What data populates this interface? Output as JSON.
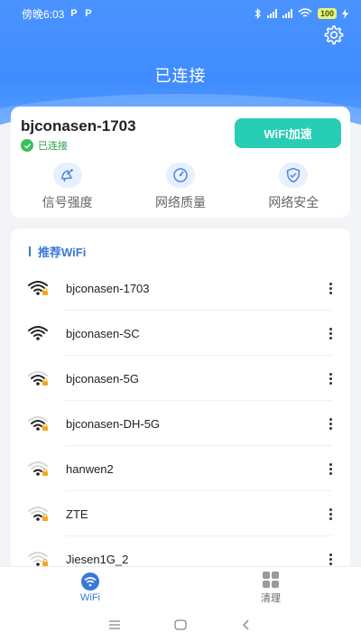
{
  "status_bar": {
    "time": "傍晚6:03",
    "app_badges": [
      "P",
      "P"
    ],
    "battery": "100"
  },
  "header": {
    "title": "已连接"
  },
  "connection": {
    "ssid": "bjconasen-1703",
    "status": "已连接",
    "boost_label": "WiFi加速",
    "metrics": [
      {
        "label": "信号强度",
        "icon": "satellite-dish-icon"
      },
      {
        "label": "网络质量",
        "icon": "speedometer-icon"
      },
      {
        "label": "网络安全",
        "icon": "shield-icon"
      }
    ]
  },
  "recommended": {
    "title": "推荐WiFi",
    "networks": [
      {
        "name": "bjconasen-1703",
        "signal": 4,
        "locked": true
      },
      {
        "name": "bjconasen-SC",
        "signal": 4,
        "locked": false
      },
      {
        "name": "bjconasen-5G",
        "signal": 3,
        "locked": true
      },
      {
        "name": "bjconasen-DH-5G",
        "signal": 3,
        "locked": true
      },
      {
        "name": "hanwen2",
        "signal": 2,
        "locked": true
      },
      {
        "name": "ZTE",
        "signal": 2,
        "locked": true
      },
      {
        "name": "Jiesen1G_2",
        "signal": 1,
        "locked": true
      }
    ]
  },
  "tabs": [
    {
      "label": "WiFi",
      "icon": "wifi-icon",
      "active": true
    },
    {
      "label": "清理",
      "icon": "grid-icon",
      "active": false
    }
  ],
  "colors": {
    "brand": "#3f8cff",
    "accent": "#27cdb4",
    "active_tab": "#3a77d8",
    "inactive_tab": "#888888",
    "lock": "#f5a623"
  }
}
